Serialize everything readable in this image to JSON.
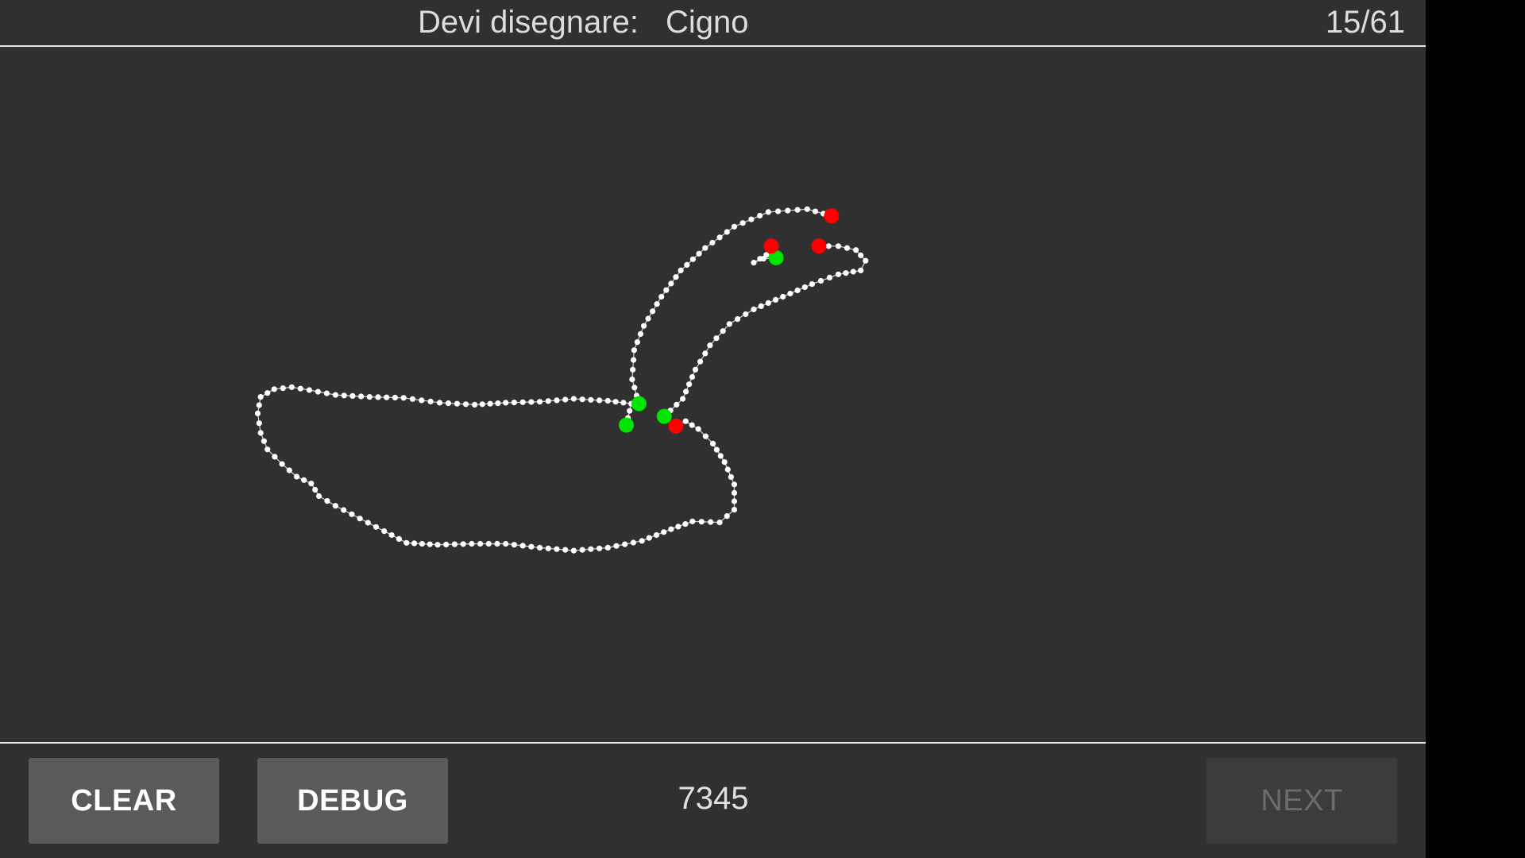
{
  "header": {
    "prompt_label": "Devi disegnare:",
    "prompt_word": "Cigno",
    "counter": "15/61"
  },
  "footer": {
    "clear_label": "CLEAR",
    "debug_label": "DEBUG",
    "score": "7345",
    "next_label": "NEXT",
    "next_enabled": false
  },
  "colors": {
    "background": "#303030",
    "stroke": "#ffffff",
    "stroke_start": "#00e600",
    "stroke_end": "#ff0000"
  }
}
